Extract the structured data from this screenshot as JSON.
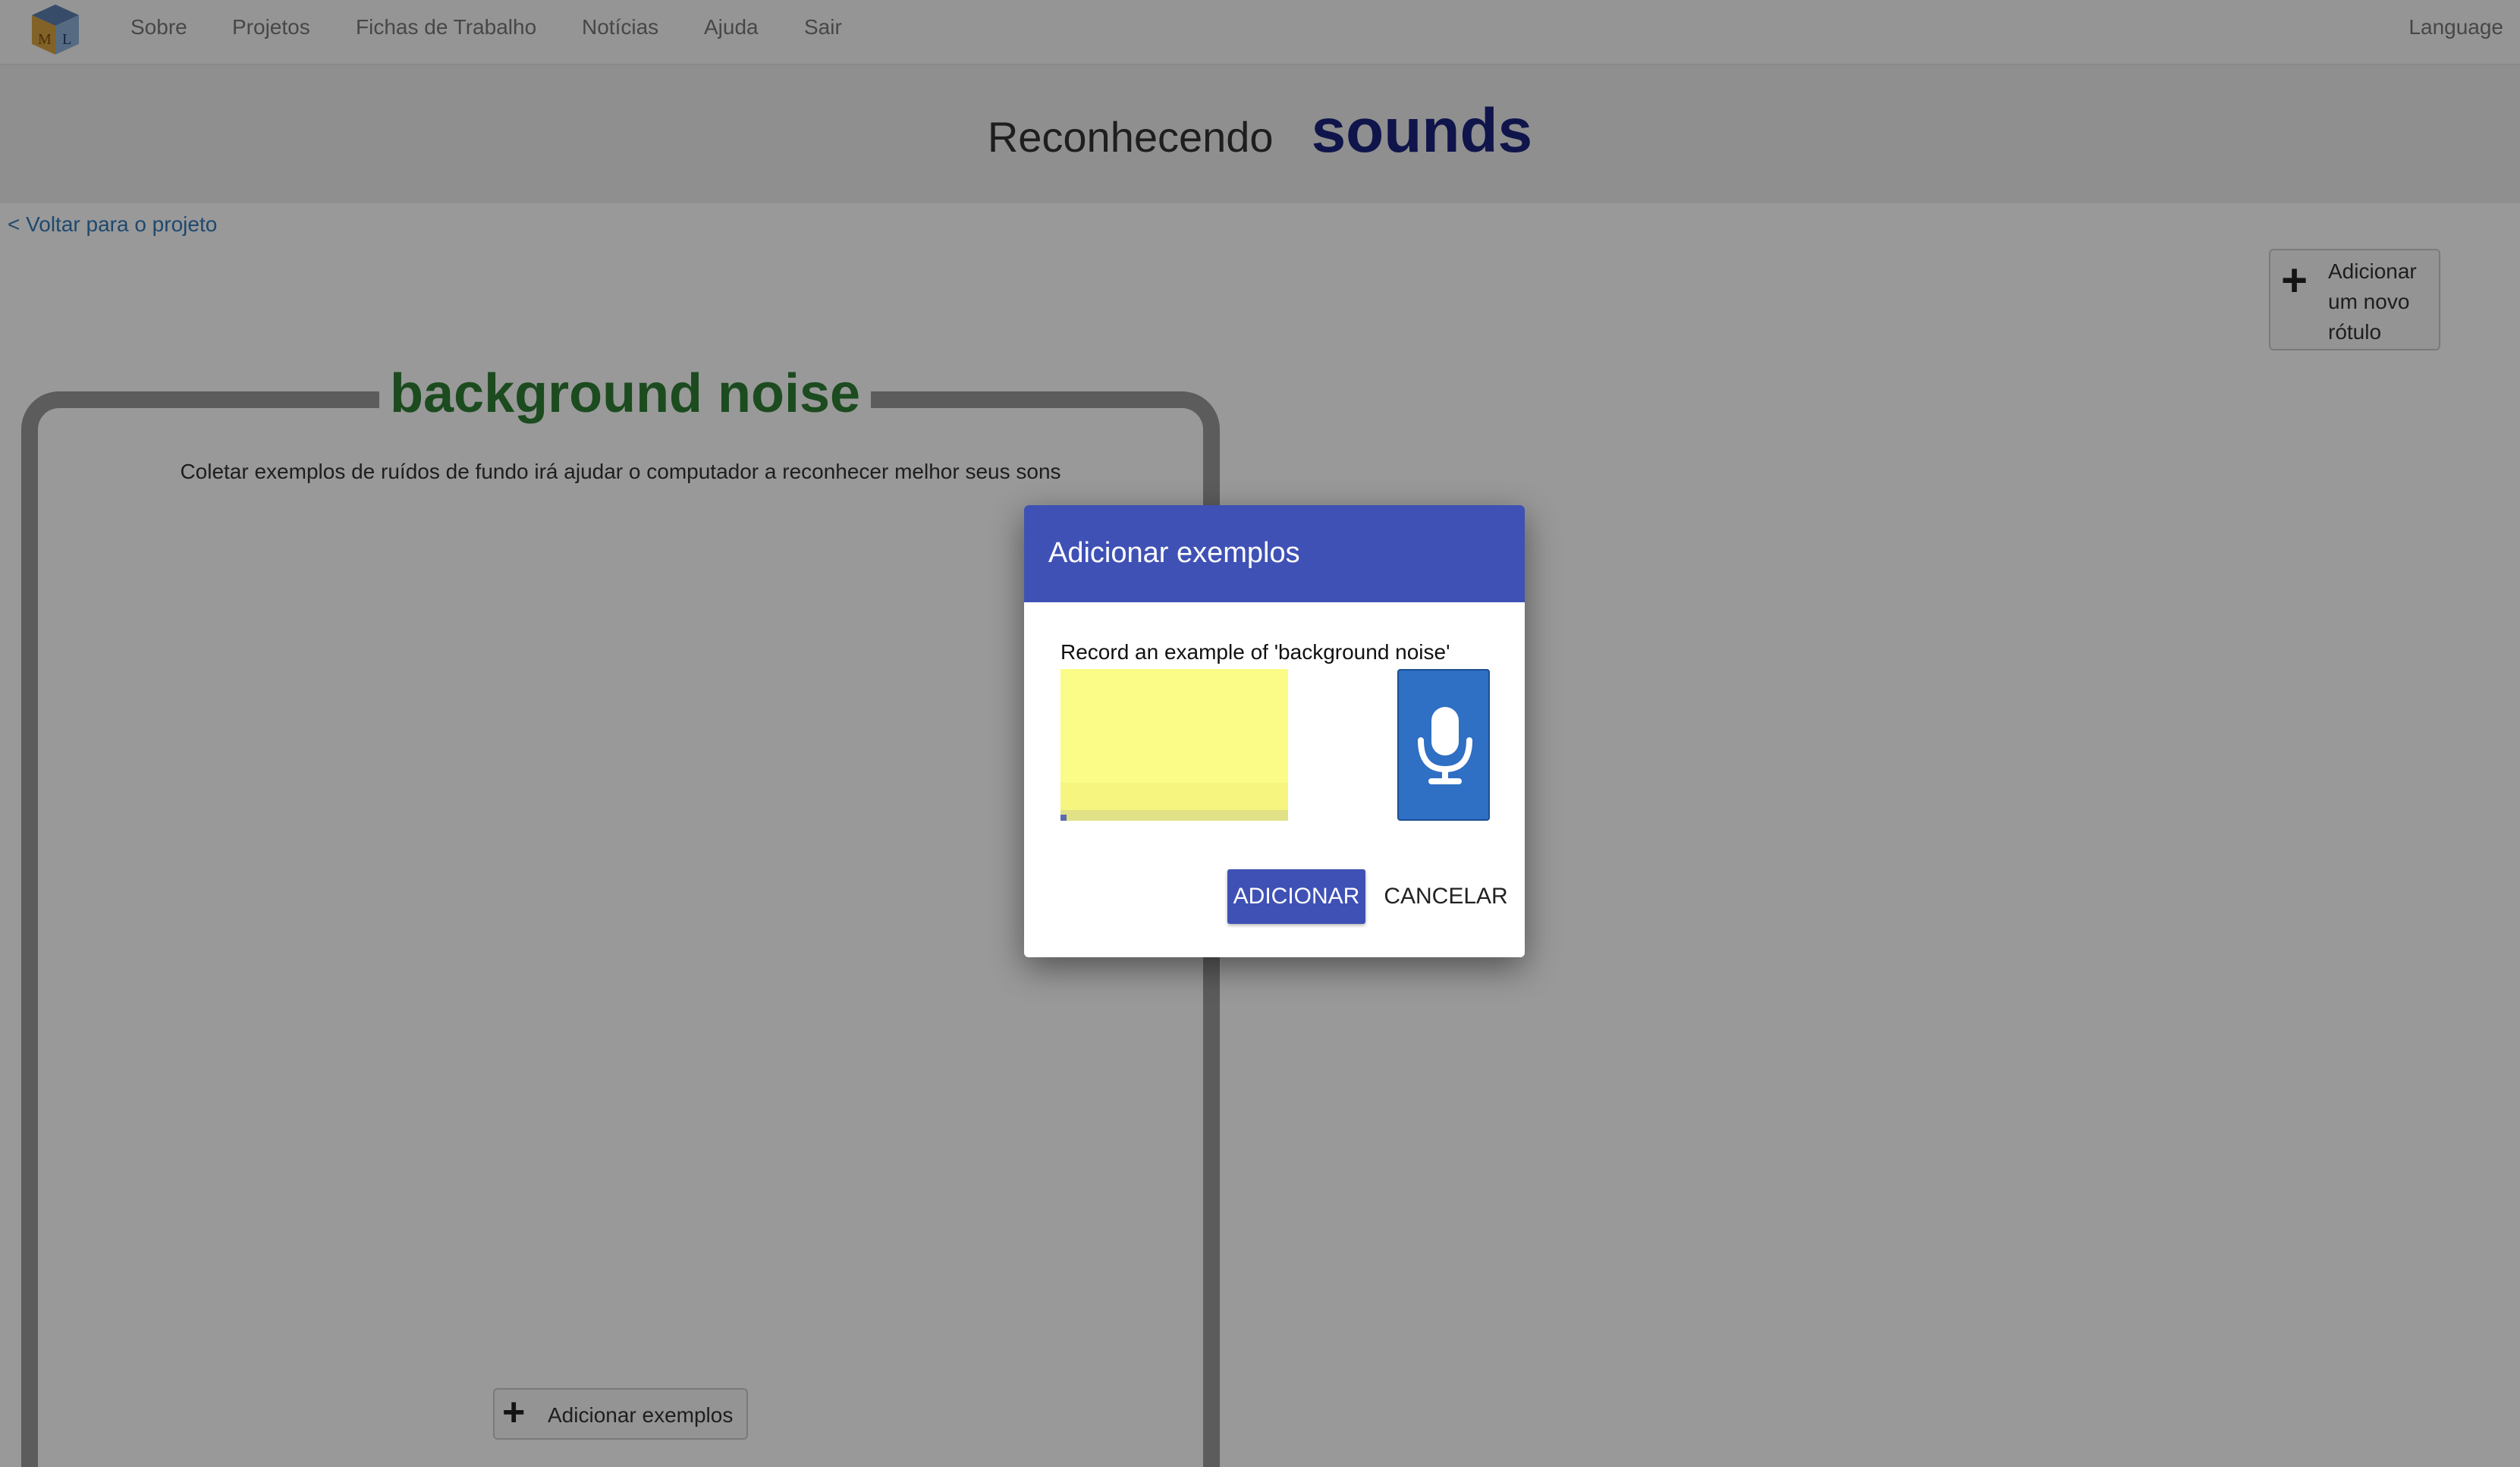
{
  "navbar": {
    "items": [
      {
        "label": "Sobre"
      },
      {
        "label": "Projetos"
      },
      {
        "label": "Fichas de Trabalho"
      },
      {
        "label": "Notícias"
      },
      {
        "label": "Ajuda"
      },
      {
        "label": "Sair"
      }
    ],
    "language_label": "Language",
    "logo_letters": [
      "M",
      "L"
    ]
  },
  "banner": {
    "prefix": "Reconhecendo",
    "project_type": "sounds"
  },
  "back_link": "< Voltar para o projeto",
  "add_label_button": {
    "label": "Adicionar um novo rótulo",
    "icon": "plus-icon"
  },
  "bucket": {
    "title": "background noise",
    "description": "Coletar exemplos de ruídos de fundo irá ajudar o computador a reconhecer melhor seus sons",
    "add_examples_label": "Adicionar exemplos"
  },
  "dialog": {
    "title": "Adicionar exemplos",
    "prompt": "Record an example of 'background noise'",
    "mic_icon": "microphone-icon",
    "add_button": "ADICIONAR",
    "cancel_button": "CANCELAR"
  },
  "colors": {
    "dialog_header": "#3f51b5",
    "project_title": "#1a237e",
    "bucket_title": "#2e7d32",
    "mic_button": "#2f6fc4",
    "spectrogram": "#fbfb88",
    "link": "#337ab7"
  }
}
